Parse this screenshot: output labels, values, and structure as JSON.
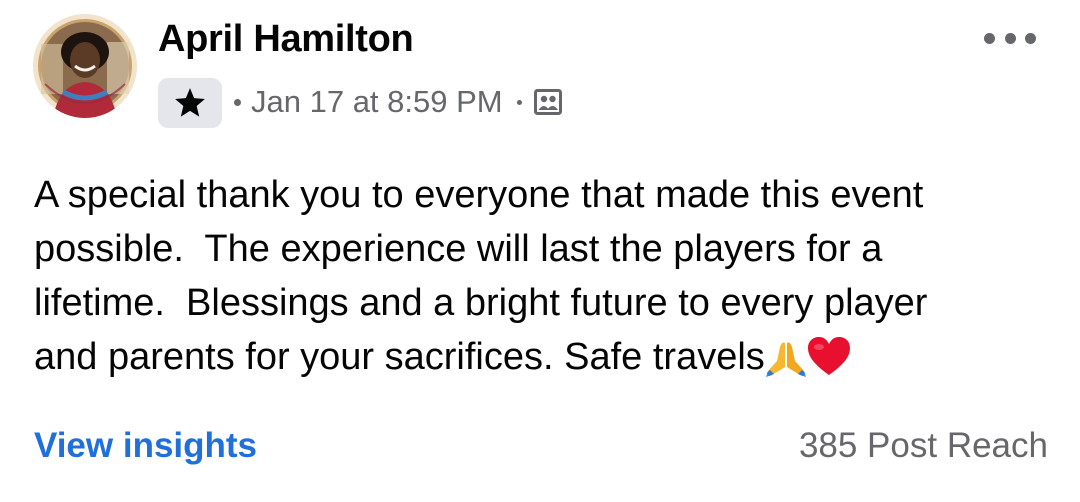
{
  "post": {
    "author": {
      "name": "April Hamilton",
      "avatar_icon": "profile-photo-avatar",
      "badge_icon": "star-icon"
    },
    "timestamp": "Jan 17 at 8:59 PM",
    "audience_icon": "group-audience-icon",
    "more_icon": "more-options-icon",
    "text_lines": [
      "A special thank you to everyone that made this event",
      "possible.  The experience will last the players for a",
      "lifetime.  Blessings and a bright future to every player",
      "and parents for your sacrifices. Safe travels"
    ],
    "emojis": [
      "folded-hands-emoji",
      "red-heart-emoji"
    ],
    "view_insights_label": "View insights",
    "post_reach": "385 Post Reach"
  },
  "colors": {
    "link": "#216fdb",
    "secondary_text": "#65676b",
    "primary_text": "#050505",
    "badge_bg": "#e4e6eb",
    "heart": "#e8102e",
    "hands": "#f5b82e"
  }
}
